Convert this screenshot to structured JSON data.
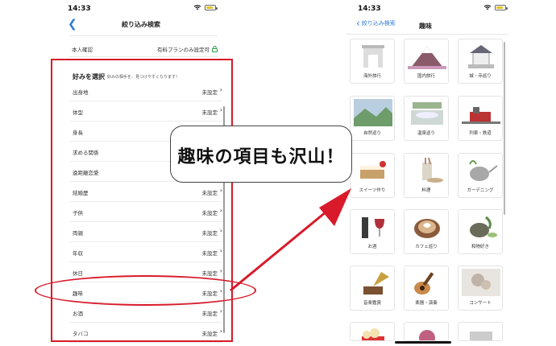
{
  "left_phone": {
    "time": "14:33",
    "title": "絞り込み検索",
    "verify": {
      "label": "本人確認",
      "value": "有料プランのみ設定可"
    },
    "section": {
      "title": "好みを選択",
      "subtitle": "好みの相手を、見つけやすくなります！"
    },
    "rows": [
      {
        "label": "出身地",
        "value": "未設定"
      },
      {
        "label": "体型",
        "value": "未設定"
      },
      {
        "label": "身長",
        "value": ""
      },
      {
        "label": "求める関係",
        "value": ""
      },
      {
        "label": "遠距離恋愛",
        "value": ""
      },
      {
        "label": "結婚歴",
        "value": "未設定"
      },
      {
        "label": "子供",
        "value": "未設定"
      },
      {
        "label": "両親",
        "value": "未設定"
      },
      {
        "label": "年収",
        "value": "未設定"
      },
      {
        "label": "休日",
        "value": "未設定"
      },
      {
        "label": "趣味",
        "value": "未設定"
      },
      {
        "label": "お酒",
        "value": "未設定"
      },
      {
        "label": "タバコ",
        "value": "未設定"
      }
    ]
  },
  "right_phone": {
    "time": "14:33",
    "back_label": "絞り込み検索",
    "title": "趣味",
    "hobbies": [
      {
        "label": "海外旅行",
        "icon": "arch-icon"
      },
      {
        "label": "国内旅行",
        "icon": "mountain-icon"
      },
      {
        "label": "城・寺巡り",
        "icon": "castle-icon"
      },
      {
        "label": "自然巡り",
        "icon": "nature-icon"
      },
      {
        "label": "温泉巡り",
        "icon": "onsen-icon"
      },
      {
        "label": "列車・鉄道",
        "icon": "train-icon"
      },
      {
        "label": "スイーツ作り",
        "icon": "sweets-icon"
      },
      {
        "label": "料理",
        "icon": "cooking-icon"
      },
      {
        "label": "ガーデニング",
        "icon": "gardening-icon"
      },
      {
        "label": "お酒",
        "icon": "wine-icon"
      },
      {
        "label": "カフェ巡り",
        "icon": "coffee-icon"
      },
      {
        "label": "和物好き",
        "icon": "tea-icon"
      },
      {
        "label": "音楽鑑賞",
        "icon": "gramophone-icon"
      },
      {
        "label": "楽器・演奏",
        "icon": "guitar-icon"
      },
      {
        "label": "コンサート",
        "icon": "concert-icon"
      },
      {
        "label": "",
        "icon": "popcorn-icon"
      },
      {
        "label": "",
        "icon": "flower-icon"
      },
      {
        "label": "",
        "icon": "misc-icon"
      }
    ]
  },
  "callout": {
    "text": "趣味の項目も沢山！"
  },
  "colors": {
    "accent_red": "#d81a2a",
    "ios_blue": "#2f7bd8",
    "lock_green": "#2e9e4e"
  }
}
